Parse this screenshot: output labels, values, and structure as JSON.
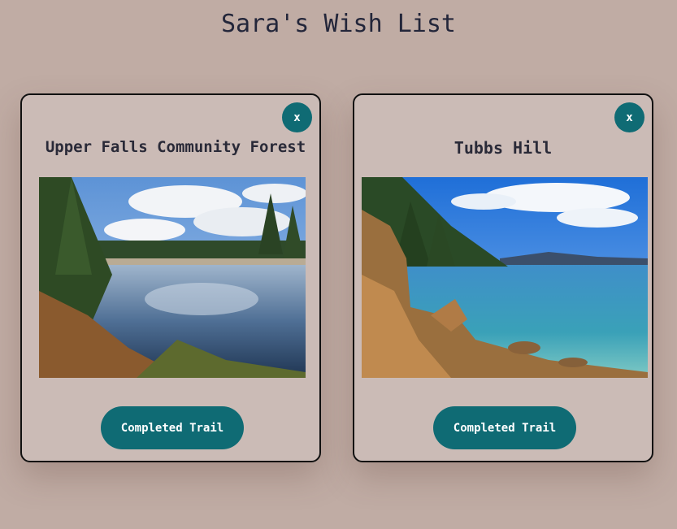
{
  "page": {
    "title": "Sara's Wish List"
  },
  "cards": [
    {
      "title": "Upper Falls Community Forest",
      "close_label": "x",
      "image_icon": "forest-river-photo",
      "button_label": "Completed Trail"
    },
    {
      "title": "Tubbs Hill",
      "close_label": "x",
      "image_icon": "lake-shoreline-photo",
      "button_label": "Completed Trail"
    }
  ],
  "colors": {
    "background": "#c0aca4",
    "card": "#cbbbb6",
    "accent": "#0f6b74",
    "title_text": "#23263a"
  }
}
